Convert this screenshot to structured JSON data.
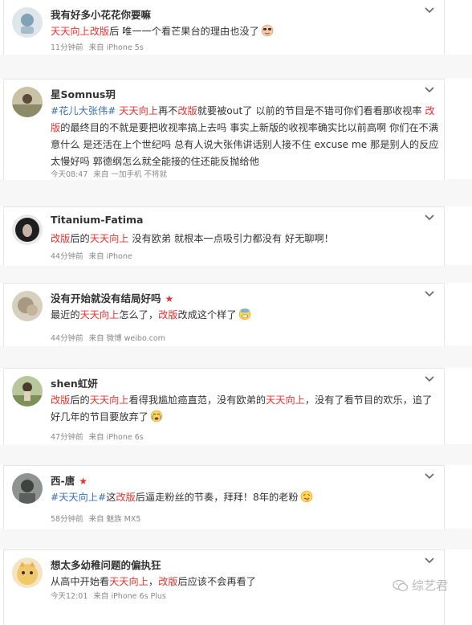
{
  "comments": [
    {
      "username": "我有好多小花花你要嘛",
      "text": [
        {
          "t": "天天向上改版",
          "c": "hl"
        },
        {
          "t": "后 唯一一个看芒果台的理由也没了"
        }
      ],
      "emoji": "sunglasses-face-icon",
      "time": "11分钟前",
      "source": "来自 iPhone 5s"
    },
    {
      "username": "星Somnus玥",
      "text": [
        {
          "t": "#花儿大张伟#",
          "c": "tag"
        },
        {
          "t": " "
        },
        {
          "t": "天天向上",
          "c": "hl"
        },
        {
          "t": "再不"
        },
        {
          "t": "改版",
          "c": "hl"
        },
        {
          "t": "就要被out了 以前的节目是不错可你们看看那收视率 "
        },
        {
          "t": "改版",
          "c": "hl"
        },
        {
          "t": "的最终目的不就是要把收视率搞上去吗 事实上新版的收视率确实比以前高啊 你们在不满意什么 是还活在上个世纪吗 总有人说大张伟讲话别人接不住 excuse me 那是别人的反应太慢好吗 郭德纲怎么就全能接的住还能反抛给他"
        }
      ],
      "time": "今天08:47",
      "source": "来自 一加手机 不将就"
    },
    {
      "username": "Titanium-Fatima",
      "text": [
        {
          "t": "改版",
          "c": "hl"
        },
        {
          "t": "后的"
        },
        {
          "t": "天天向上",
          "c": "hl"
        },
        {
          "t": " 没有欧弟 就根本一点吸引力都没有 好无聊啊！"
        }
      ],
      "time": "44分钟前",
      "source": "来自 iPhone"
    },
    {
      "username": "没有开始就没有结局好吗",
      "star": "★",
      "text": [
        {
          "t": "最近的"
        },
        {
          "t": "天天向上",
          "c": "hl"
        },
        {
          "t": "怎么了，"
        },
        {
          "t": "改版",
          "c": "hl"
        },
        {
          "t": "改成这个样了"
        }
      ],
      "emoji": "cold-sweat-face-icon",
      "time": "44分钟前",
      "source": "来自 微博 weibo.com"
    },
    {
      "username": "shen虹妍",
      "text": [
        {
          "t": "改版",
          "c": "hl"
        },
        {
          "t": "后的"
        },
        {
          "t": "天天向上",
          "c": "hl"
        },
        {
          "t": "看得我尴尬癌直范，没有欧弟的"
        },
        {
          "t": "天天向上",
          "c": "hl"
        },
        {
          "t": "，没有了看节目的欢乐，追了好几年的节目要放弃了"
        }
      ],
      "emoji": "crying-face-icon",
      "time": "47分钟前",
      "source": "来自 iPhone 6s"
    },
    {
      "username": "西-唐",
      "star": "★",
      "text": [
        {
          "t": "#天天向上#",
          "c": "tag"
        },
        {
          "t": "这"
        },
        {
          "t": "改版",
          "c": "hl"
        },
        {
          "t": "后逼走粉丝的节奏，拜拜！8年的老粉"
        }
      ],
      "emoji": "tongue-face-icon",
      "time": "58分钟前",
      "source": "来自 魅族 MX5"
    },
    {
      "username": "想太多幼稚问题的偏执狂",
      "text": [
        {
          "t": "从高中开始看"
        },
        {
          "t": "天天向上",
          "c": "hl"
        },
        {
          "t": "，"
        },
        {
          "t": "改版",
          "c": "hl"
        },
        {
          "t": "后应该不会再看了"
        }
      ],
      "time": "今天12:01",
      "source": "来自 iPhone 6s Plus"
    }
  ],
  "watermark": "综艺君",
  "colors": {
    "highlight": "#e8322f",
    "tag": "#3a6fb5",
    "meta": "#888888",
    "username": "#333333"
  }
}
